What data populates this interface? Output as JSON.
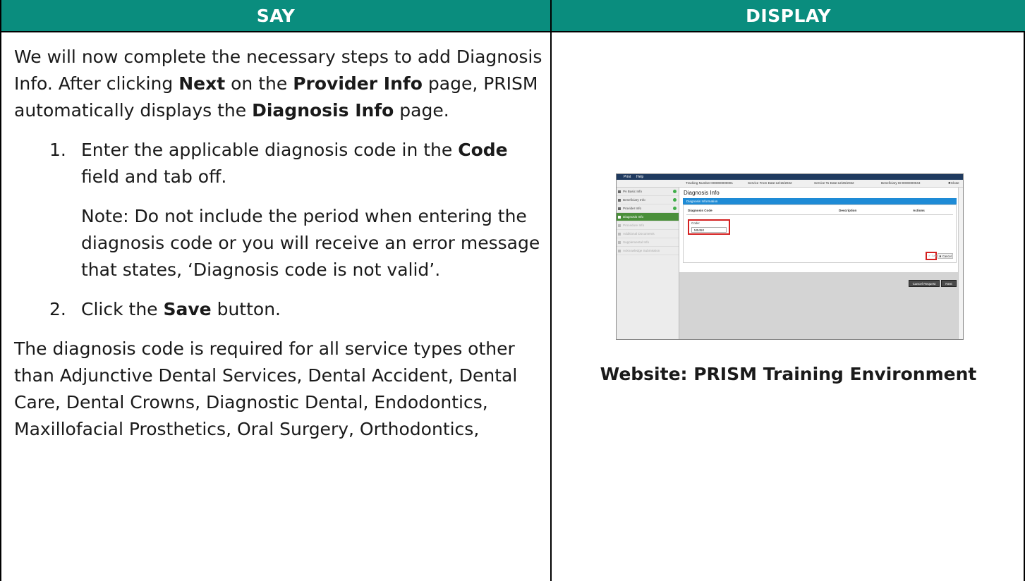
{
  "header": {
    "say": "SAY",
    "display": "DISPLAY"
  },
  "say": {
    "p1_a": "We will now complete the necessary steps to add Diagnosis Info. After clicking ",
    "p1_next": "Next",
    "p1_b": " on the ",
    "p1_provider": "Provider Info",
    "p1_c": " page, PRISM automatically displays the ",
    "p1_diag": "Diagnosis Info",
    "p1_d": " page.",
    "step1_num": "1.",
    "step1_a": "Enter the applicable diagnosis code in the ",
    "step1_code": "Code",
    "step1_b": " field and tab off.",
    "note": "Note: Do not include the period when entering the diagnosis code or you will receive an error message that states, ‘Diagnosis code is not valid’.",
    "step2_num": "2.",
    "step2_a": "Click the ",
    "step2_save": "Save",
    "step2_b": " button.",
    "p2": "The diagnosis code is required for all service types other than Adjunctive Dental Services, Dental Accident, Dental Care, Dental Crowns, Diagnostic Dental, Endodontics, Maxillofacial Prosthetics, Oral Surgery, Orthodontics,"
  },
  "screenshot": {
    "print": "Print",
    "help": "Help",
    "tracking": "Tracking Number:000000000001",
    "service_from": "Service From Date:12/15/2022",
    "service_to": "Service To Date:12/26/2022",
    "beneficiary": "Beneficiary ID:0000000043",
    "close": "✖Close",
    "sidebar": [
      {
        "label": "PA Basic Info"
      },
      {
        "label": "Beneficiary Info"
      },
      {
        "label": "Provider Info"
      },
      {
        "label": "Diagnosis Info"
      },
      {
        "label": "Procedure Info"
      },
      {
        "label": "Additional Documents"
      },
      {
        "label": "Supplemental Info"
      },
      {
        "label": "Acknowledge Submission"
      }
    ],
    "title": "Diagnosis Info",
    "section": "Diagnosis Information",
    "col_code": "Diagnosis Code",
    "col_desc": "Description",
    "col_actions": "Actions",
    "code_label": "Code:",
    "code_value": "M5450",
    "save": "✔ Save",
    "cancel": "✖ Cancel",
    "cancel_request": "Cancel Request",
    "next": "Next"
  },
  "caption": "Website: PRISM Training Environment"
}
